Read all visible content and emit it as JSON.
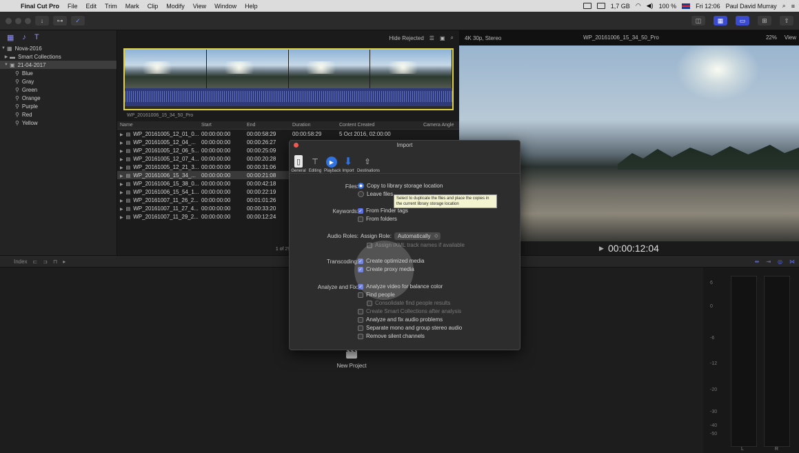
{
  "menubar": {
    "app": "Final Cut Pro",
    "items": [
      "File",
      "Edit",
      "Trim",
      "Mark",
      "Clip",
      "Modify",
      "View",
      "Window",
      "Help"
    ],
    "memory": "1,7 GB",
    "battery": "100 %",
    "clock": "Fri 12:06",
    "user": "Paul David Murray"
  },
  "browser": {
    "hide_rejected": "Hide Rejected",
    "clip_label": "WP_20161006_15_34_50_Pro",
    "columns": [
      "Name",
      "Start",
      "End",
      "Duration",
      "Content Created",
      "Camera Angle"
    ],
    "rows": [
      {
        "name": "WP_20161005_12_01_0...",
        "start": "00:00:00:00",
        "end": "00:00:58:29",
        "duration": "00:00:58:29",
        "created": "5 Oct 2016, 02:00:00"
      },
      {
        "name": "WP_20161005_12_04_...",
        "start": "00:00:00:00",
        "end": "00:00:26:27"
      },
      {
        "name": "WP_20161005_12_06_5...",
        "start": "00:00:00:00",
        "end": "00:00:25:09"
      },
      {
        "name": "WP_20161005_12_07_4...",
        "start": "00:00:00:00",
        "end": "00:00:20:28"
      },
      {
        "name": "WP_20161005_12_21_3...",
        "start": "00:00:00:00",
        "end": "00:00:31:06"
      },
      {
        "name": "WP_20161006_15_34_...",
        "start": "00:00:00:00",
        "end": "00:00:21:08"
      },
      {
        "name": "WP_20161006_15_38_0...",
        "start": "00:00:00:00",
        "end": "00:00:42:18"
      },
      {
        "name": "WP_20161006_15_54_1...",
        "start": "00:00:00:00",
        "end": "00:00:22:19"
      },
      {
        "name": "WP_20161007_11_26_2...",
        "start": "00:00:00:00",
        "end": "00:01:01:26"
      },
      {
        "name": "WP_20161007_11_27_4...",
        "start": "00:00:00:00",
        "end": "00:00:33:20"
      },
      {
        "name": "WP_20161007_11_29_2...",
        "start": "00:00:00:00",
        "end": "00:00:12:24"
      }
    ],
    "footer": "1 of 29 sele"
  },
  "sidebar": {
    "library": "Nova-2016",
    "smart_collections": "Smart Collections",
    "event": "21-04-2017",
    "keywords": [
      "Blue",
      "Gray",
      "Green",
      "Orange",
      "Purple",
      "Red",
      "Yellow"
    ]
  },
  "viewer": {
    "format": "4K 30p, Stereo",
    "title": "WP_20161006_15_34_50_Pro",
    "zoom": "22%",
    "view": "View",
    "timecode": "00:00:12:04"
  },
  "timeline": {
    "new_project": "New Project",
    "index": "Index"
  },
  "meters": {
    "scale": [
      "6",
      "0",
      "-6",
      "-12",
      "-20",
      "-30",
      "-40",
      "-50"
    ],
    "channels": [
      "L",
      "R"
    ]
  },
  "dialog": {
    "title": "Import",
    "tabs": [
      "General",
      "Editing",
      "Playback",
      "Import",
      "Destinations"
    ],
    "files_label": "Files:",
    "files_copy": "Copy to library storage location",
    "files_leave": "Leave files",
    "tooltip": "Select to duplicate the files and place the copies in the current library storage location",
    "keywords_label": "Keywords:",
    "kw_finder": "From Finder tags",
    "kw_folders": "From folders",
    "audio_label": "Audio Roles:",
    "assign_role": "Assign Role:",
    "assign_value": "Automatically",
    "ixml": "Assign iXML track names if available",
    "transcoding_label": "Transcoding:",
    "optimized": "Create optimized media",
    "proxy": "Create proxy media",
    "analyze_label": "Analyze and Fix:",
    "balance": "Analyze video for balance color",
    "find_people": "Find people",
    "consolidate": "Consolidate find people results",
    "smart_coll": "Create Smart Collections after analysis",
    "audio_problems": "Analyze and fix audio problems",
    "separate_mono": "Separate mono and group stereo audio",
    "remove_silent": "Remove silent channels"
  }
}
